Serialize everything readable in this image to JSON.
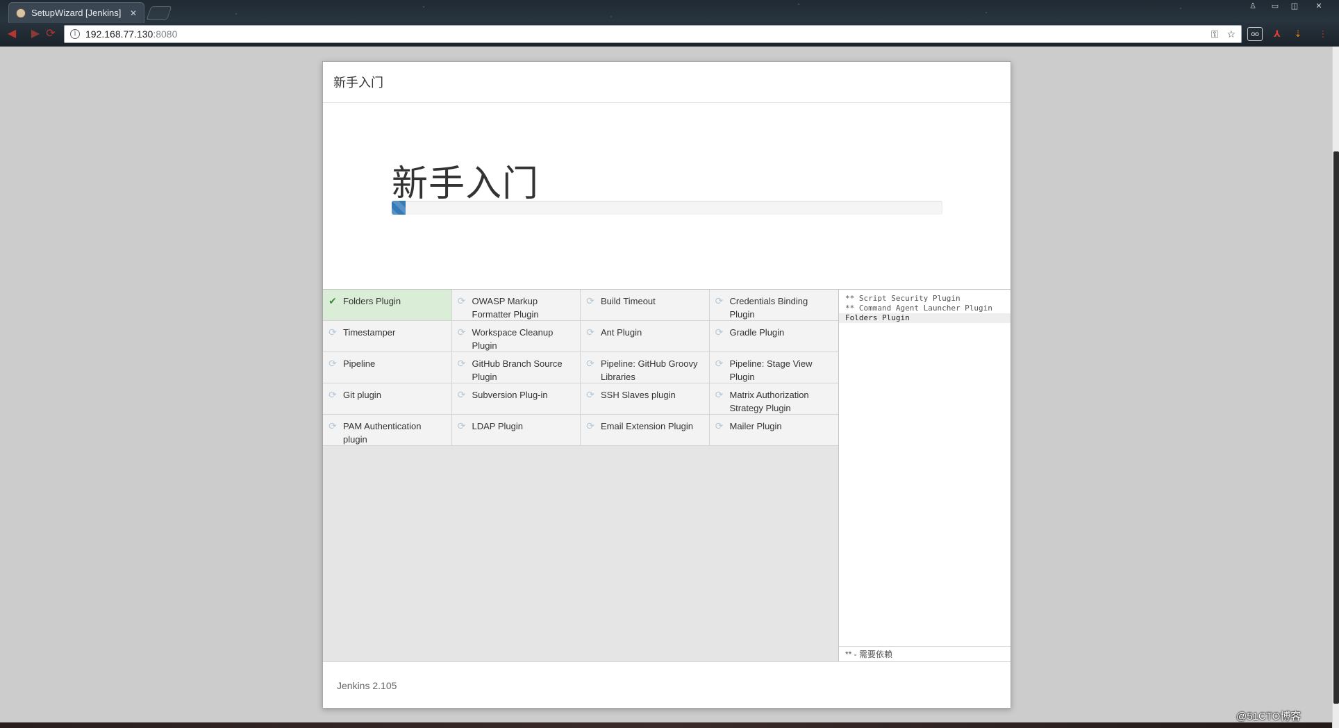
{
  "browser": {
    "tab_title": "SetupWizard [Jenkins]",
    "tab_close": "✕",
    "url_host": "192.168.77.130",
    "url_port": ":8080",
    "window_controls": {
      "profile": "♙",
      "minimize": "▭",
      "maximize": "◫",
      "close": "✕"
    }
  },
  "dialog": {
    "header_title": "新手入门",
    "hero_title": "新手入门",
    "progress_percent": 2.5,
    "plugins": [
      {
        "name": "Folders Plugin",
        "status": "success",
        "icon": "check-icon"
      },
      {
        "name": "OWASP Markup Formatter Plugin",
        "status": "pending",
        "icon": "refresh-icon"
      },
      {
        "name": "Build Timeout",
        "status": "pending",
        "icon": "refresh-icon"
      },
      {
        "name": "Credentials Binding Plugin",
        "status": "pending",
        "icon": "refresh-icon"
      },
      {
        "name": "Timestamper",
        "status": "pending",
        "icon": "refresh-icon"
      },
      {
        "name": "Workspace Cleanup Plugin",
        "status": "pending",
        "icon": "refresh-icon"
      },
      {
        "name": "Ant Plugin",
        "status": "pending",
        "icon": "refresh-icon"
      },
      {
        "name": "Gradle Plugin",
        "status": "pending",
        "icon": "refresh-icon"
      },
      {
        "name": "Pipeline",
        "status": "pending",
        "icon": "refresh-icon"
      },
      {
        "name": "GitHub Branch Source Plugin",
        "status": "pending",
        "icon": "refresh-icon"
      },
      {
        "name": "Pipeline: GitHub Groovy Libraries",
        "status": "pending",
        "icon": "refresh-icon"
      },
      {
        "name": "Pipeline: Stage View Plugin",
        "status": "pending",
        "icon": "refresh-icon"
      },
      {
        "name": "Git plugin",
        "status": "pending",
        "icon": "refresh-icon"
      },
      {
        "name": "Subversion Plug-in",
        "status": "pending",
        "icon": "refresh-icon"
      },
      {
        "name": "SSH Slaves plugin",
        "status": "pending",
        "icon": "refresh-icon"
      },
      {
        "name": "Matrix Authorization Strategy Plugin",
        "status": "pending",
        "icon": "refresh-icon"
      },
      {
        "name": "PAM Authentication plugin",
        "status": "pending",
        "icon": "refresh-icon"
      },
      {
        "name": "LDAP Plugin",
        "status": "pending",
        "icon": "refresh-icon"
      },
      {
        "name": "Email Extension Plugin",
        "status": "pending",
        "icon": "refresh-icon"
      },
      {
        "name": "Mailer Plugin",
        "status": "pending",
        "icon": "refresh-icon"
      }
    ],
    "log": {
      "lines": [
        {
          "text": "** Script Security Plugin",
          "current": false
        },
        {
          "text": "** Command Agent Launcher Plugin",
          "current": false
        },
        {
          "text": "Folders Plugin",
          "current": true
        }
      ],
      "legend": "** - 需要依赖"
    },
    "footer_version": "Jenkins 2.105"
  },
  "watermark": "@51CTO博客",
  "colors": {
    "progress": "#337ab7",
    "success_bg": "#d9edd7",
    "check": "#3c8b3c",
    "pending_icon": "#b6c7d6"
  }
}
